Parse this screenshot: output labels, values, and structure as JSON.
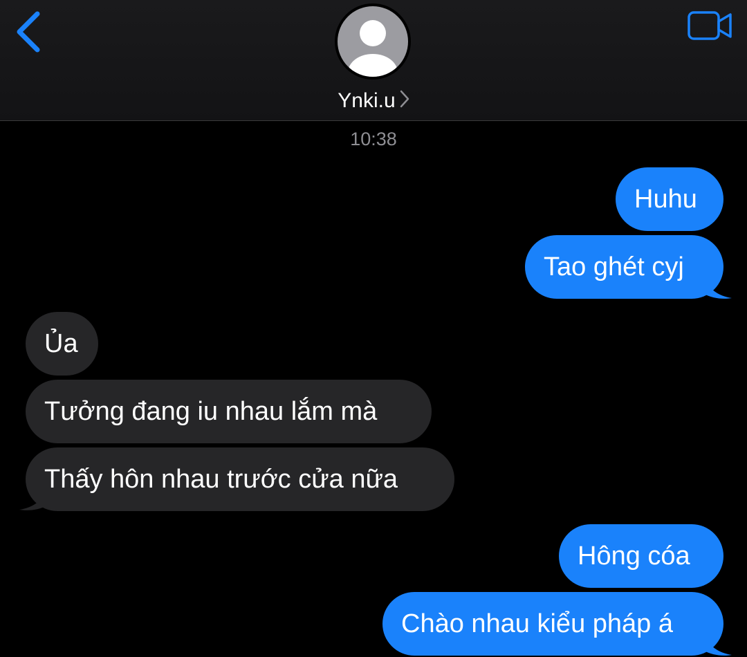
{
  "header": {
    "contact_name": "Ynki.u",
    "back_icon": "chevron-left-icon",
    "video_icon": "video-camera-icon",
    "avatar_icon": "person-silhouette-icon"
  },
  "thread": {
    "timestamp": "10:38",
    "messages": [
      {
        "direction": "sent",
        "text": "Huhu"
      },
      {
        "direction": "sent",
        "text": "Tao ghét cyj"
      },
      {
        "direction": "received",
        "text": "Ủa"
      },
      {
        "direction": "received",
        "text": "Tưởng đang iu nhau lắm mà"
      },
      {
        "direction": "received",
        "text": "Thấy hôn nhau trước cửa nữa"
      },
      {
        "direction": "sent",
        "text": "Hông cóa"
      },
      {
        "direction": "sent",
        "text": "Chào nhau kiểu pháp á"
      }
    ]
  },
  "colors": {
    "background": "#000000",
    "accent": "#1a82fb",
    "sent_bubble": "#1a82fb",
    "received_bubble": "#262628",
    "timestamp_text": "#8e8e93"
  }
}
